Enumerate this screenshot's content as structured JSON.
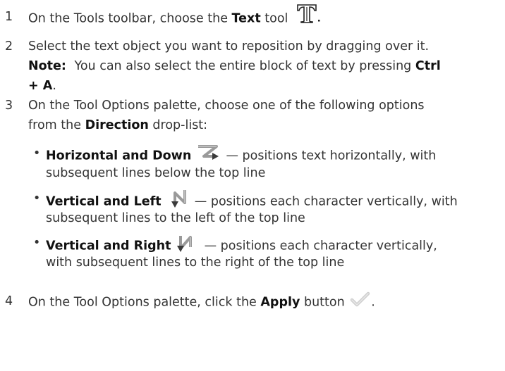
{
  "steps": [
    {
      "number": "1",
      "pre": "On the Tools toolbar, choose the",
      "bold": "Text",
      "post": "tool",
      "icon": "text-tool-icon"
    },
    {
      "number": "2",
      "text": "Select the text object you want to reposition by dragging over it.",
      "note": {
        "label": "Note:",
        "text": "You can also select the entire block of text by pressing",
        "key1": "Ctrl",
        "key2": "+ A",
        "end": "."
      }
    },
    {
      "number": "3",
      "line1": "On the Tool Options palette, choose one of the following options",
      "line2_pre": "from the",
      "line2_bold": "Direction",
      "line2_post": "drop-list:",
      "options": [
        {
          "bold": "Horizontal and Down",
          "icon": "horizontal-down-icon",
          "line1": "— positions text horizontally, with",
          "line2": "subsequent lines below the top line"
        },
        {
          "bold": "Vertical and Left",
          "icon": "vertical-left-icon",
          "line1": "— positions each character vertically, with",
          "line2": "subsequent lines to the left of the top line"
        },
        {
          "bold": "Vertical and Right",
          "icon": "vertical-right-icon",
          "line1": "— positions each character vertically,",
          "line2": "with subsequent lines to the right of the top line"
        }
      ]
    },
    {
      "number": "4",
      "pre": "On the Tool Options palette, click the",
      "bold": "Apply",
      "post": "button",
      "end": ".",
      "icon": "apply-checkmark-icon"
    }
  ]
}
